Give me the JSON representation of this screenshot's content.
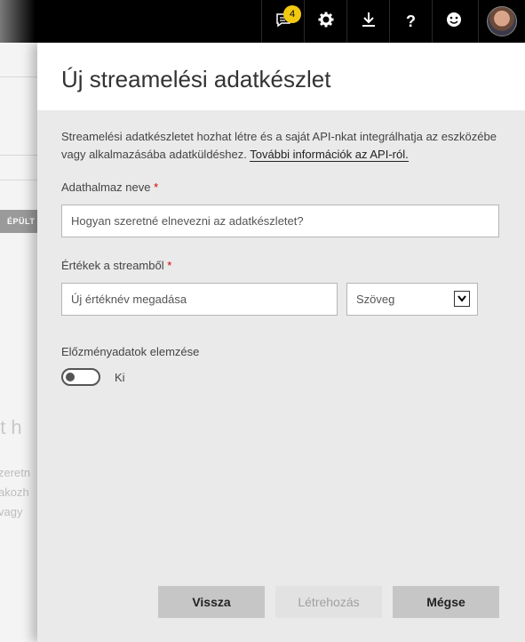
{
  "topbar": {
    "notification_count": "4",
    "icons": [
      "notification-icon",
      "gear-icon",
      "download-icon",
      "help-icon",
      "smiley-icon",
      "avatar"
    ]
  },
  "background": {
    "tag": "ÉPÜLT",
    "big_text": "'t h",
    "small_lines": [
      "zeretn",
      "akozh",
      "vagy"
    ]
  },
  "panel": {
    "title": "Új streamelési adatkészlet",
    "description": "Streamelési adatkészletet hozhat létre és a saját API-nkat integrálhatja az eszközébe vagy alkalmazásába adatküldéshez.",
    "link": "További információk az API-ról.",
    "dataset_name_label": "Adathalmaz neve",
    "dataset_name_placeholder": "Hogyan szeretné elnevezni az adatkészletet?",
    "values_label": "Értékek a streamből",
    "value_name_placeholder": "Új értéknév megadása",
    "value_type": "Szöveg",
    "history_label": "Előzményadatok elemzése",
    "history_state": "Ki",
    "required_mark": "*"
  },
  "footer": {
    "back_label": "Vissza",
    "create_label": "Létrehozás",
    "cancel_label": "Mégse"
  },
  "colors": {
    "badge": "#f2c811",
    "required": "#cc0000"
  }
}
